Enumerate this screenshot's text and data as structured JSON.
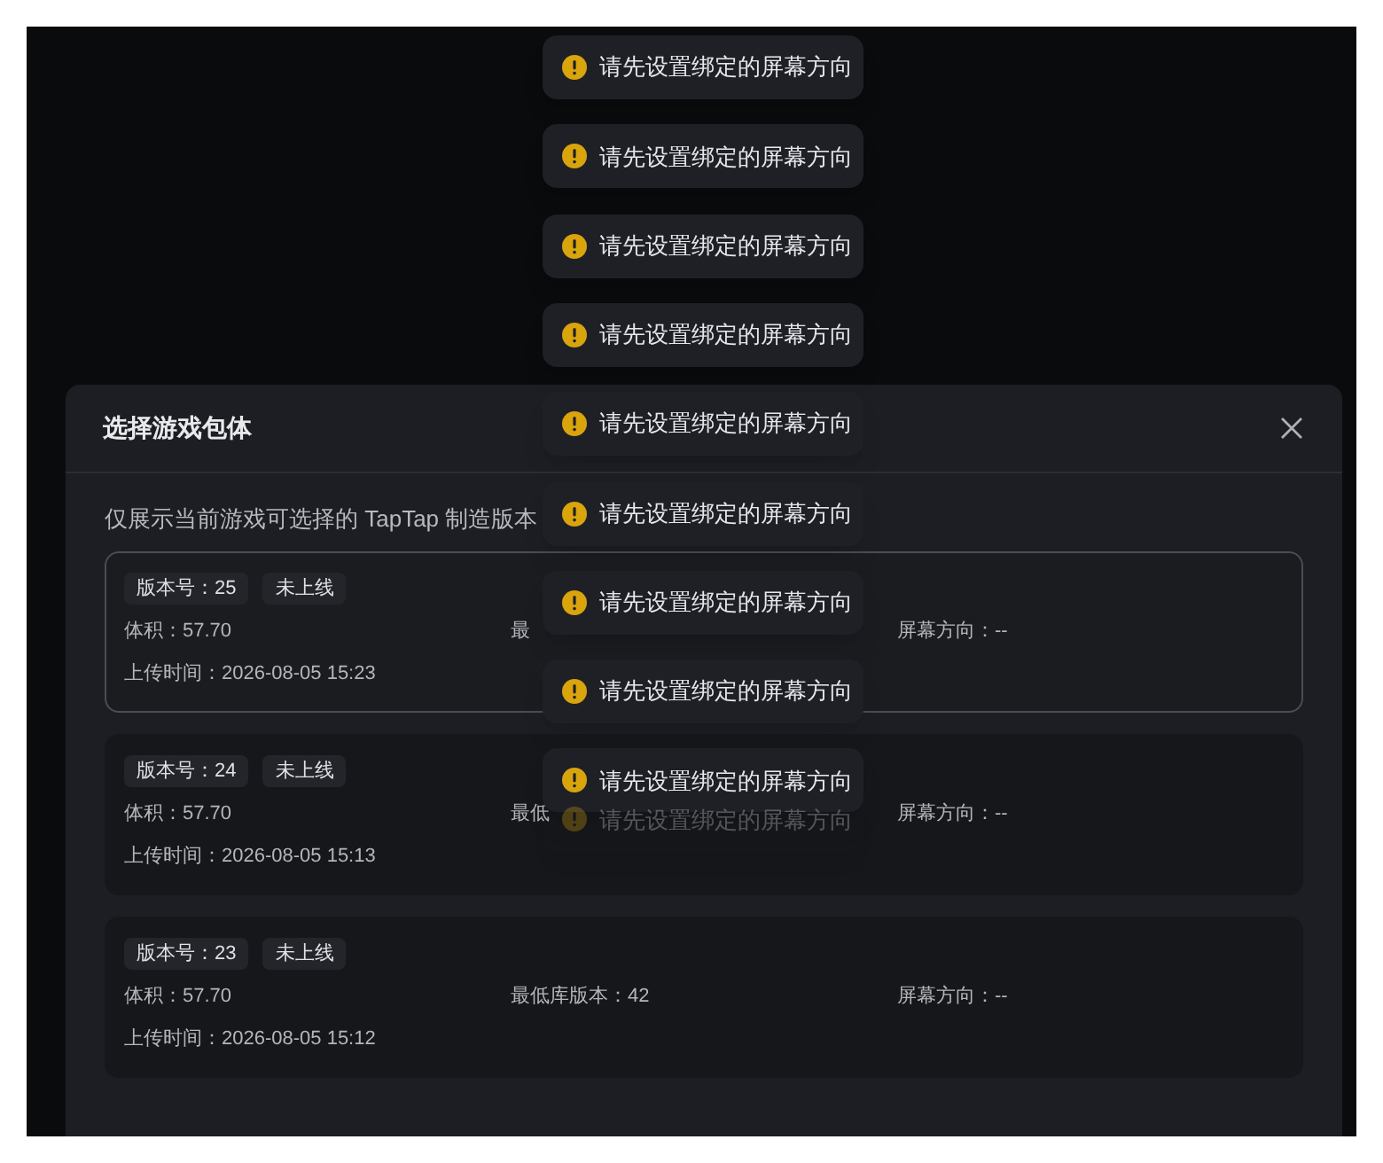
{
  "toasts": [
    {
      "text": "请先设置绑定的屏幕方向",
      "fading": false
    },
    {
      "text": "请先设置绑定的屏幕方向",
      "fading": false
    },
    {
      "text": "请先设置绑定的屏幕方向",
      "fading": false
    },
    {
      "text": "请先设置绑定的屏幕方向",
      "fading": false
    },
    {
      "text": "请先设置绑定的屏幕方向",
      "fading": false
    },
    {
      "text": "请先设置绑定的屏幕方向",
      "fading": false
    },
    {
      "text": "请先设置绑定的屏幕方向",
      "fading": false
    },
    {
      "text": "请先设置绑定的屏幕方向",
      "fading": false
    },
    {
      "text": "请先设置绑定的屏幕方向",
      "fading": false
    },
    {
      "text": "请先设置绑定的屏幕方向",
      "fading": true
    }
  ],
  "dialog": {
    "title": "选择游戏包体",
    "intro": "仅展示当前游戏可选择的 TapTap 制造版本",
    "packages": [
      {
        "version": "版本号：25",
        "status": "未上线",
        "size": "体积：57.70",
        "min_lib": "最",
        "orientation": "屏幕方向：--",
        "uploaded": "上传时间：2026-08-05 15:23",
        "selected": true
      },
      {
        "version": "版本号：24",
        "status": "未上线",
        "size": "体积：57.70",
        "min_lib": "最低",
        "orientation": "屏幕方向：--",
        "uploaded": "上传时间：2026-08-05 15:13",
        "selected": false
      },
      {
        "version": "版本号：23",
        "status": "未上线",
        "size": "体积：57.70",
        "min_lib": "最低库版本：42",
        "orientation": "屏幕方向：--",
        "uploaded": "上传时间：2026-08-05 15:12",
        "selected": false
      }
    ]
  }
}
